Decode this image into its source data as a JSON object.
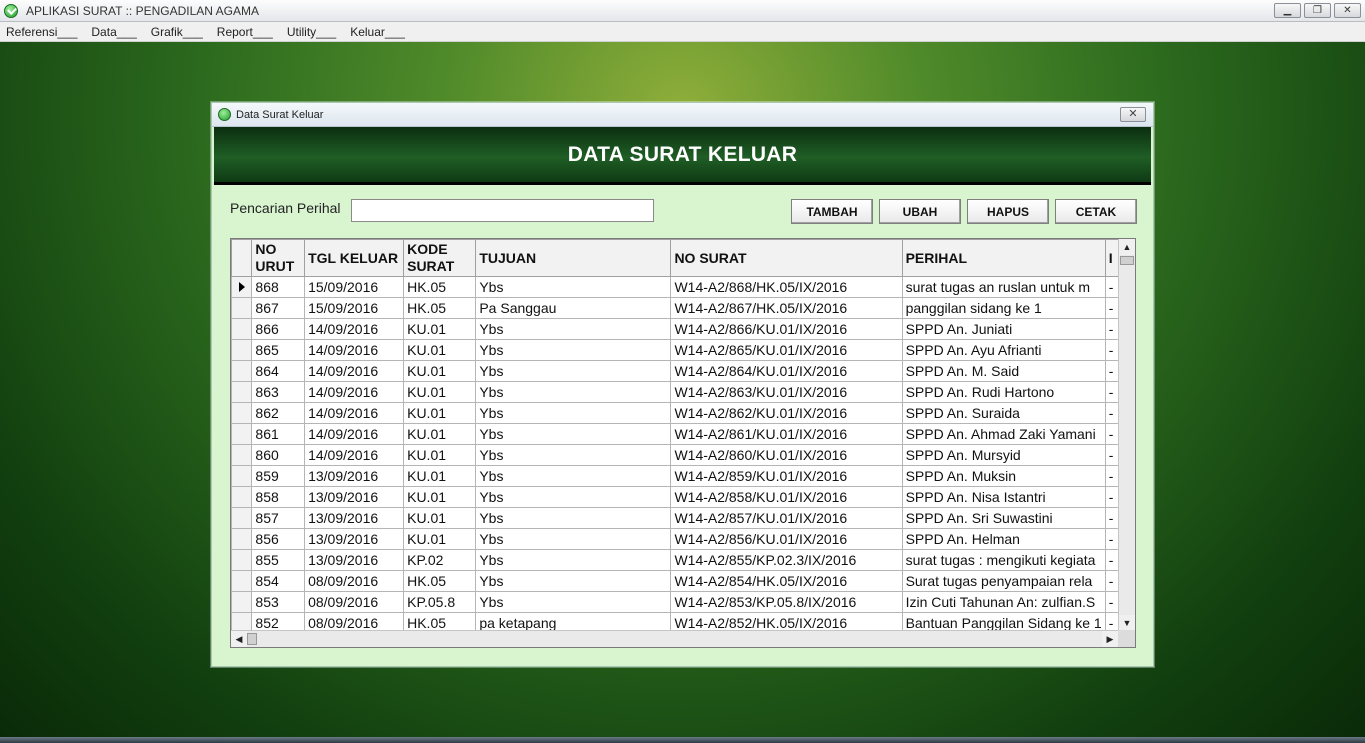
{
  "app": {
    "title": "APLIKASI SURAT :: PENGADILAN AGAMA",
    "menu": [
      "Referensi___",
      "Data___",
      "Grafik___",
      "Report___",
      "Utility___",
      "Keluar___"
    ]
  },
  "window": {
    "title": "Data Surat Keluar",
    "banner": "DATA SURAT KELUAR",
    "close_glyph": "✕"
  },
  "search": {
    "label": "Pencarian Perihal",
    "value": ""
  },
  "buttons": {
    "tambah": "TAMBAH",
    "ubah": "UBAH",
    "hapus": "HAPUS",
    "cetak": "CETAK"
  },
  "grid": {
    "columns": [
      "NO URUT",
      "TGL KELUAR",
      "KODE SURAT",
      "TUJUAN",
      "NO SURAT",
      "PERIHAL",
      "I"
    ],
    "rows": [
      [
        "868",
        "15/09/2016",
        "HK.05",
        "Ybs",
        "W14-A2/868/HK.05/IX/2016",
        "surat tugas an ruslan untuk m",
        "-"
      ],
      [
        "867",
        "15/09/2016",
        "HK.05",
        "Pa Sanggau",
        "W14-A2/867/HK.05/IX/2016",
        "panggilan sidang ke 1",
        "-"
      ],
      [
        "866",
        "14/09/2016",
        "KU.01",
        "Ybs",
        "W14-A2/866/KU.01/IX/2016",
        "SPPD An. Juniati",
        "-"
      ],
      [
        "865",
        "14/09/2016",
        "KU.01",
        "Ybs",
        "W14-A2/865/KU.01/IX/2016",
        "SPPD An. Ayu Afrianti",
        "-"
      ],
      [
        "864",
        "14/09/2016",
        "KU.01",
        "Ybs",
        "W14-A2/864/KU.01/IX/2016",
        "SPPD An. M. Said",
        "-"
      ],
      [
        "863",
        "14/09/2016",
        "KU.01",
        "Ybs",
        "W14-A2/863/KU.01/IX/2016",
        "SPPD An. Rudi Hartono",
        "-"
      ],
      [
        "862",
        "14/09/2016",
        "KU.01",
        "Ybs",
        "W14-A2/862/KU.01/IX/2016",
        "SPPD An. Suraida",
        "-"
      ],
      [
        "861",
        "14/09/2016",
        "KU.01",
        "Ybs",
        "W14-A2/861/KU.01/IX/2016",
        "SPPD An. Ahmad Zaki Yamani",
        "-"
      ],
      [
        "860",
        "14/09/2016",
        "KU.01",
        "Ybs",
        "W14-A2/860/KU.01/IX/2016",
        "SPPD An. Mursyid",
        "-"
      ],
      [
        "859",
        "13/09/2016",
        "KU.01",
        "Ybs",
        "W14-A2/859/KU.01/IX/2016",
        "SPPD An. Muksin",
        "-"
      ],
      [
        "858",
        "13/09/2016",
        "KU.01",
        "Ybs",
        "W14-A2/858/KU.01/IX/2016",
        "SPPD An. Nisa Istantri",
        "-"
      ],
      [
        "857",
        "13/09/2016",
        "KU.01",
        "Ybs",
        "W14-A2/857/KU.01/IX/2016",
        "SPPD An. Sri Suwastini",
        "-"
      ],
      [
        "856",
        "13/09/2016",
        "KU.01",
        "Ybs",
        "W14-A2/856/KU.01/IX/2016",
        "SPPD An. Helman",
        "-"
      ],
      [
        "855",
        "13/09/2016",
        "KP.02",
        "Ybs",
        "W14-A2/855/KP.02.3/IX/2016",
        "surat tugas : mengikuti kegiata",
        "-"
      ],
      [
        "854",
        "08/09/2016",
        "HK.05",
        "Ybs",
        "W14-A2/854/HK.05/IX/2016",
        "Surat tugas penyampaian rela",
        "-"
      ],
      [
        "853",
        "08/09/2016",
        "KP.05.8",
        "Ybs",
        "W14-A2/853/KP.05.8/IX/2016",
        "Izin Cuti Tahunan An: zulfian.S",
        "-"
      ],
      [
        "852",
        "08/09/2016",
        "HK.05",
        "pa ketapang",
        "W14-A2/852/HK.05/IX/2016",
        "Bantuan Panggilan Sidang ke 1",
        "-"
      ]
    ],
    "selected_row": 0
  }
}
